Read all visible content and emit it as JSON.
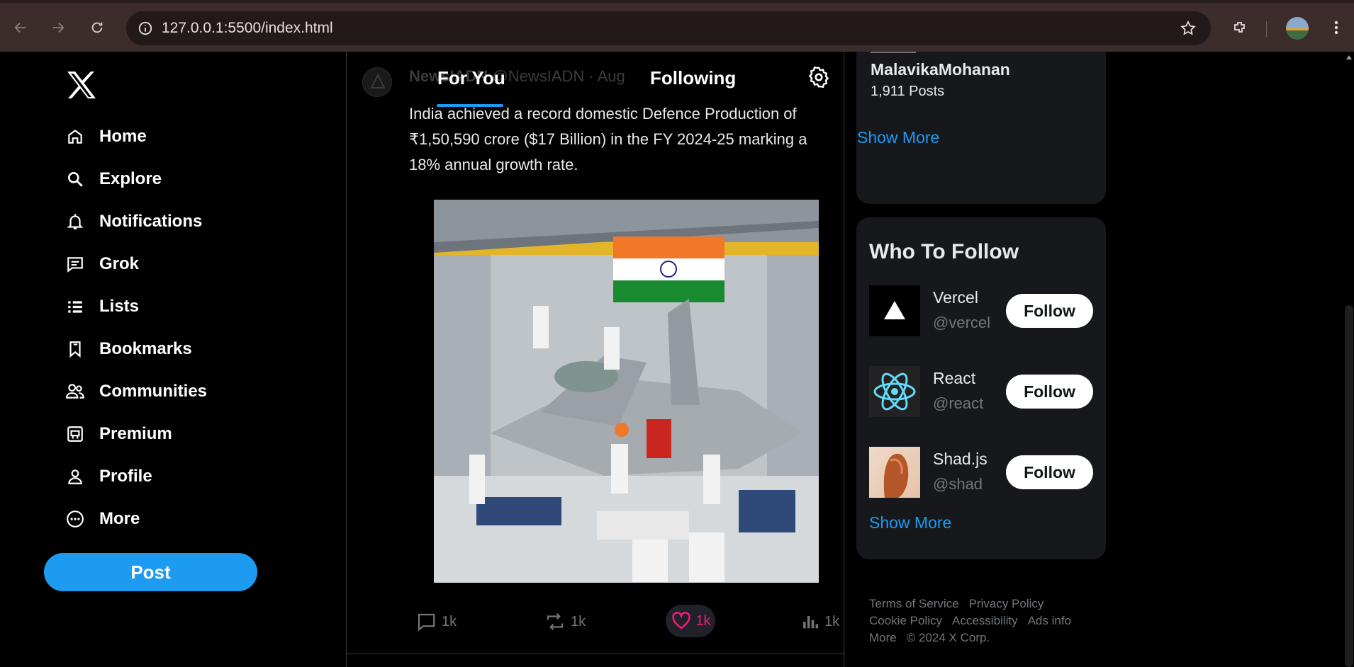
{
  "browser": {
    "url": "127.0.0.1:5500/index.html"
  },
  "sidebar": {
    "items": [
      {
        "label": "Home",
        "icon": "home-icon"
      },
      {
        "label": "Explore",
        "icon": "search-icon"
      },
      {
        "label": "Notifications",
        "icon": "bell-icon"
      },
      {
        "label": "Grok",
        "icon": "message-icon"
      },
      {
        "label": "Lists",
        "icon": "list-icon"
      },
      {
        "label": "Bookmarks",
        "icon": "bookmark-icon"
      },
      {
        "label": "Communities",
        "icon": "people-icon"
      },
      {
        "label": "Premium",
        "icon": "premium-icon"
      },
      {
        "label": "Profile",
        "icon": "person-icon"
      },
      {
        "label": "More",
        "icon": "more-circle-icon"
      }
    ],
    "post_label": "Post"
  },
  "feed": {
    "tabs": [
      "For You",
      "Following"
    ],
    "active_tab": "For You",
    "tweet": {
      "author": "NewsIADN",
      "handle": "@NewsIADN · Aug",
      "text": "India achieved a record domestic Defence Production of ₹1,50,590 crore ($17 Billion) in the FY 2024-25 marking a 18% annual growth rate.",
      "actions": {
        "reply": "1k",
        "retweet": "1k",
        "like": "1k",
        "views": "1k"
      }
    }
  },
  "trending": {
    "topic": "MalavikaMohanan",
    "posts": "1,911 Posts",
    "show_more": "Show More"
  },
  "who_to_follow": {
    "title": "Who To Follow",
    "accounts": [
      {
        "name": "Vercel",
        "handle": "@vercel",
        "follow": "Follow"
      },
      {
        "name": "React",
        "handle": "@react",
        "follow": "Follow"
      },
      {
        "name": "Shad.js",
        "handle": "@shad",
        "follow": "Follow"
      }
    ],
    "show_more": "Show More"
  },
  "footer": {
    "links": [
      "Terms of Service",
      "Privacy Policy",
      "Cookie Policy",
      "Accessibility",
      "Ads info",
      "More",
      "© 2024 X Corp."
    ]
  },
  "colors": {
    "accent": "#1d9bf0",
    "like": "#f91880",
    "panel": "#16181c"
  }
}
